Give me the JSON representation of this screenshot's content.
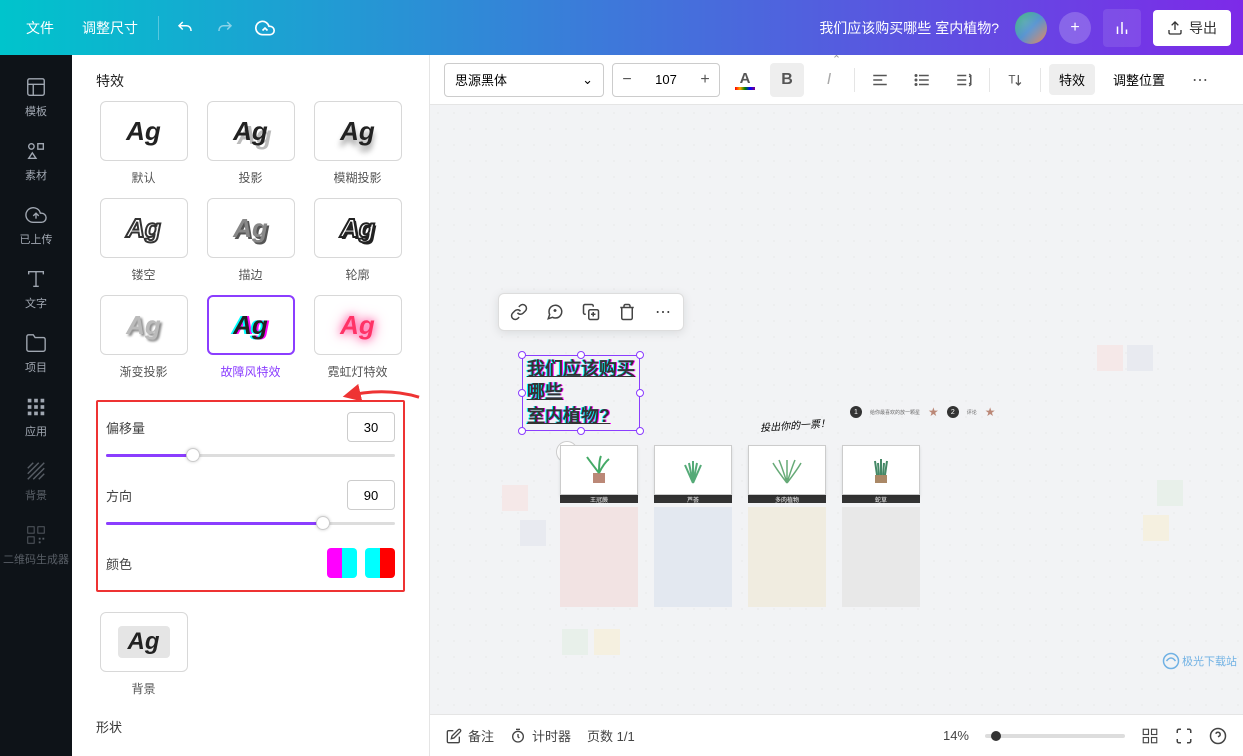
{
  "header": {
    "file": "文件",
    "resize": "调整尺寸",
    "doc_title": "我们应该购买哪些 室内植物?",
    "export": "导出"
  },
  "sidebar": {
    "items": [
      {
        "label": "模板",
        "icon": "template"
      },
      {
        "label": "素材",
        "icon": "elements"
      },
      {
        "label": "已上传",
        "icon": "upload"
      },
      {
        "label": "文字",
        "icon": "text"
      },
      {
        "label": "项目",
        "icon": "folder"
      },
      {
        "label": "应用",
        "icon": "apps"
      },
      {
        "label": "背景",
        "icon": "background"
      },
      {
        "label": "二维码生成器",
        "icon": "qr"
      }
    ]
  },
  "effects_panel": {
    "title": "特效",
    "effects": [
      {
        "label": "默认"
      },
      {
        "label": "投影"
      },
      {
        "label": "模糊投影"
      },
      {
        "label": "镂空"
      },
      {
        "label": "描边"
      },
      {
        "label": "轮廓"
      },
      {
        "label": "渐变投影"
      },
      {
        "label": "故障风特效"
      },
      {
        "label": "霓虹灯特效"
      }
    ],
    "controls": {
      "offset_label": "偏移量",
      "offset_value": "30",
      "direction_label": "方向",
      "direction_value": "90",
      "color_label": "颜色"
    },
    "background_effect": {
      "label": "背景"
    },
    "shape_header": "形状"
  },
  "toolbar": {
    "font_name": "思源黑体",
    "font_size": "107",
    "effects_btn": "特效",
    "adjust_pos": "调整位置"
  },
  "canvas": {
    "selected_text_line1": "我们应该购买",
    "selected_text_line2": "哪些",
    "selected_text_line3": "室内植物?",
    "vote_text": "投出你的一票！",
    "badges": [
      "1",
      "2"
    ],
    "plant_labels": [
      "王冠蕨",
      "芦荟",
      "多肉植物",
      "蛇草"
    ]
  },
  "bottom_bar": {
    "notes": "备注",
    "timer": "计时器",
    "page_count": "页数 1/1",
    "zoom": "14%"
  },
  "watermark": "极光下载站"
}
